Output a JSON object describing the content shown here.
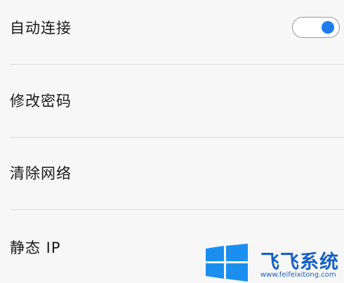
{
  "settings": {
    "items": [
      {
        "label": "自动连接",
        "toggle_on": true
      },
      {
        "label": "修改密码"
      },
      {
        "label": "清除网络"
      },
      {
        "label": "静态 IP"
      }
    ]
  },
  "colors": {
    "accent": "#1e7cf0",
    "background": "#f7f7f7",
    "divider": "#dcdcdc"
  },
  "watermark": {
    "brand": "飞飞系统",
    "url": "www.feifeixitong.com",
    "logo_icon": "windows-logo-icon"
  }
}
